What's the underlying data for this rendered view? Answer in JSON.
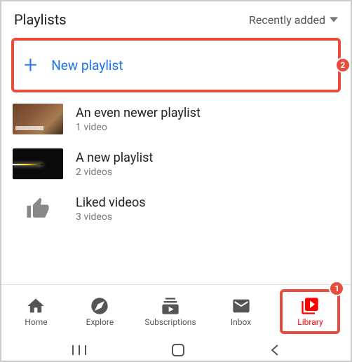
{
  "header": {
    "title": "Playlists",
    "sort_label": "Recently added"
  },
  "new_playlist": {
    "label": "New playlist"
  },
  "playlists": [
    {
      "title": "An even newer playlist",
      "subtitle": "1 video"
    },
    {
      "title": "A new playlist",
      "subtitle": "2 videos"
    },
    {
      "title": "Liked videos",
      "subtitle": "3 videos"
    }
  ],
  "nav": {
    "home": "Home",
    "explore": "Explore",
    "subscriptions": "Subscriptions",
    "inbox": "Inbox",
    "library": "Library"
  },
  "annotations": {
    "step1": "1",
    "step2": "2"
  }
}
